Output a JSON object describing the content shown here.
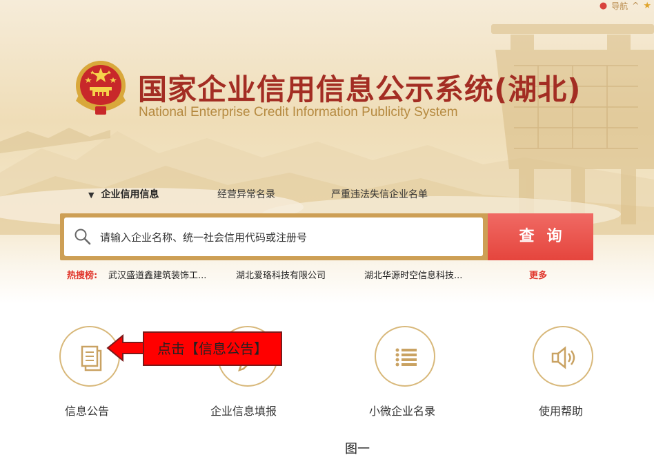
{
  "topnav": {
    "nav_label": "导航",
    "chevron": "^"
  },
  "header": {
    "title_cn": "国家企业信用信息公示系统(湖北)",
    "title_en": "National Enterprise Credit Information Publicity System"
  },
  "tabs": [
    {
      "label": "企业信用信息",
      "active": true
    },
    {
      "label": "经营异常名录",
      "active": false
    },
    {
      "label": "严重违法失信企业名单",
      "active": false
    }
  ],
  "search": {
    "placeholder": "请输入企业名称、统一社会信用代码或注册号",
    "button_label": "查询"
  },
  "hot_search": {
    "label": "热搜榜:",
    "items": [
      "武汉盛道鑫建筑装饰工...",
      "湖北爱珞科技有限公司",
      "湖北华源时空信息科技..."
    ],
    "more_label": "更多"
  },
  "features": [
    {
      "label": "信息公告",
      "icon": "document-icon"
    },
    {
      "label": "企业信息填报",
      "icon": "pen-icon"
    },
    {
      "label": "小微企业名录",
      "icon": "list-icon"
    },
    {
      "label": "使用帮助",
      "icon": "speaker-icon"
    }
  ],
  "annotation": {
    "text": "点击【信息公告】"
  },
  "caption": "图一",
  "colors": {
    "title_red": "#a32d23",
    "gold": "#cd9f55",
    "search_button": "#e5453d",
    "hot_red": "#e0352b",
    "annotation_red": "#ff0000"
  }
}
